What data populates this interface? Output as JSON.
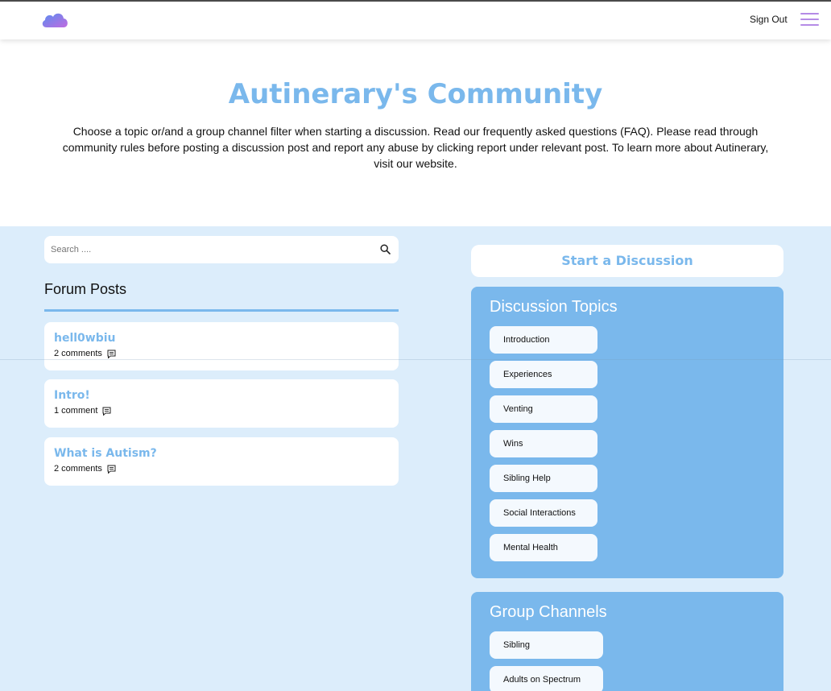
{
  "header": {
    "logo_icon": "cloud-icon",
    "sign_out_label": "Sign Out",
    "menu_icon": "hamburger-menu-icon"
  },
  "hero": {
    "title": "Autinerary's Community",
    "description": "Choose a topic or/and a group channel filter when starting a discussion. Read our frequently asked questions (FAQ). Please read through community rules before posting a discussion post and report any abuse by clicking report under relevant post. To learn more about Autinerary, visit our website."
  },
  "search": {
    "placeholder": "Search ....",
    "value": ""
  },
  "forum": {
    "title": "Forum Posts",
    "posts": [
      {
        "title": "hell0wbiu",
        "comments": "2 comments"
      },
      {
        "title": "Intro!",
        "comments": "1 comment"
      },
      {
        "title": "What is Autism?",
        "comments": "2 comments"
      }
    ]
  },
  "sidebar": {
    "start_discussion_label": "Start a Discussion",
    "topics_title": "Discussion Topics",
    "topics": [
      "Introduction",
      "Experiences",
      "Venting",
      "Wins",
      "Sibling Help",
      "Social Interactions",
      "Mental Health"
    ],
    "channels_title": "Group Channels",
    "channels": [
      "Sibling",
      "Adults on Spectrum"
    ]
  },
  "colors": {
    "accent": "#7ab8ec",
    "background": "#dcedfb",
    "menu": "#b58be6"
  }
}
